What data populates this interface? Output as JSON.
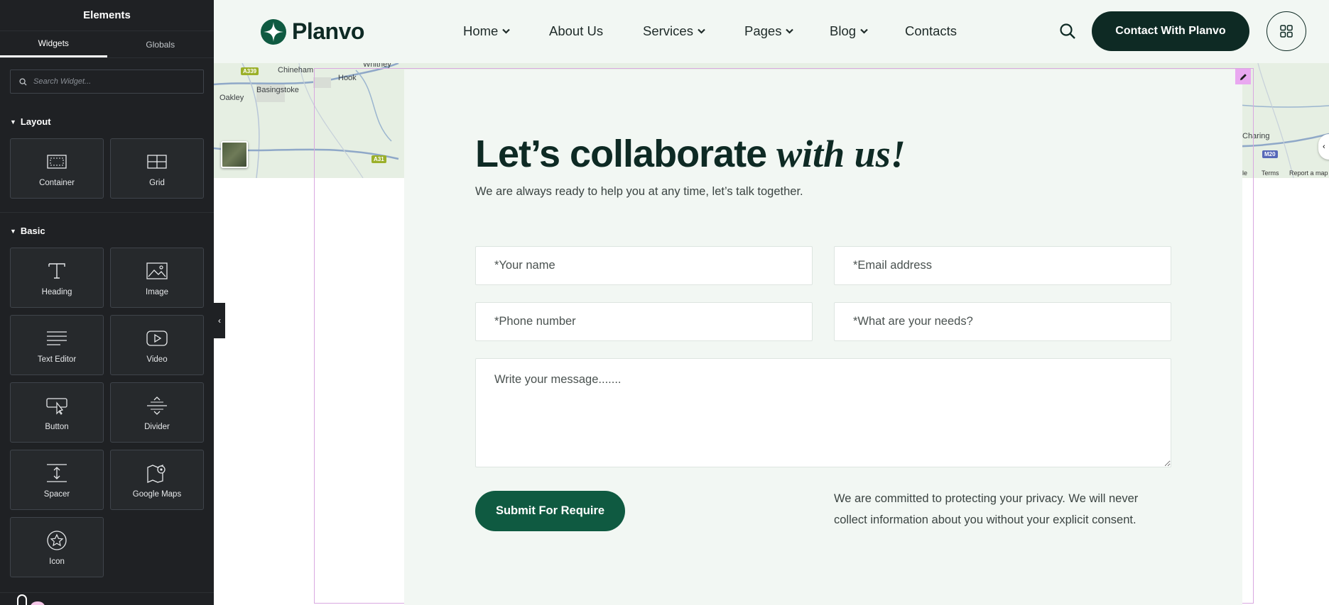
{
  "editor": {
    "panel_title": "Elements",
    "tabs": [
      {
        "label": "Widgets",
        "active": true
      },
      {
        "label": "Globals",
        "active": false
      }
    ],
    "search": {
      "placeholder": "Search Widget..."
    },
    "categories": [
      {
        "label": "Layout",
        "widgets": [
          {
            "label": "Container",
            "icon": "container-icon"
          },
          {
            "label": "Grid",
            "icon": "grid-icon"
          }
        ]
      },
      {
        "label": "Basic",
        "widgets": [
          {
            "label": "Heading",
            "icon": "heading-icon"
          },
          {
            "label": "Image",
            "icon": "image-icon"
          },
          {
            "label": "Text Editor",
            "icon": "text-editor-icon"
          },
          {
            "label": "Video",
            "icon": "video-icon"
          },
          {
            "label": "Button",
            "icon": "button-icon"
          },
          {
            "label": "Divider",
            "icon": "divider-icon"
          },
          {
            "label": "Spacer",
            "icon": "spacer-icon"
          },
          {
            "label": "Google Maps",
            "icon": "google-maps-icon"
          },
          {
            "label": "Icon",
            "icon": "star-icon"
          }
        ]
      }
    ]
  },
  "site": {
    "logo_text": "Planvo",
    "brand_color": "#0e2a24",
    "accent_color": "#0f5a41",
    "nav": [
      {
        "label": "Home",
        "has_dropdown": true
      },
      {
        "label": "About Us",
        "has_dropdown": false
      },
      {
        "label": "Services",
        "has_dropdown": true
      },
      {
        "label": "Pages",
        "has_dropdown": true
      },
      {
        "label": "Blog",
        "has_dropdown": true
      },
      {
        "label": "Contacts",
        "has_dropdown": false
      }
    ],
    "cta_label": "Contact With Planvo"
  },
  "map": {
    "places": [
      "Whitney",
      "Chineham",
      "Basingstoke",
      "Hook",
      "Oakley",
      "Charing"
    ],
    "roads": [
      "A339",
      "A31",
      "M20"
    ],
    "attribution": [
      "ogle",
      "Terms",
      "Report a map"
    ]
  },
  "contact": {
    "title_main": "Let’s collaborate",
    "title_accent": "with us!",
    "subtitle": "We are always ready to help you at any time, let’s talk together.",
    "fields": {
      "name": "*Your name",
      "email": "*Email address",
      "phone": "*Phone number",
      "needs": "*What are your needs?",
      "message": "Write your message......."
    },
    "submit_label": "Submit For Require",
    "privacy_text": "We are committed to protecting your privacy. We will never collect information about you without your explicit consent."
  }
}
